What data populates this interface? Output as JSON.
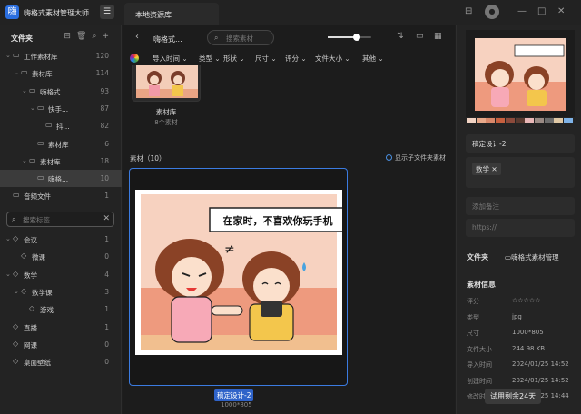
{
  "app": {
    "title": "嗨格式素材管理大师",
    "logo_glyph": "嗨"
  },
  "tab": {
    "label": "本地资源库"
  },
  "sidebar": {
    "folders_title": "文件夹",
    "tree": [
      {
        "label": "工作素材库",
        "count": "120",
        "level": 0
      },
      {
        "label": "素材库",
        "count": "114",
        "level": 1
      },
      {
        "label": "嗨格式...",
        "count": "93",
        "level": 2
      },
      {
        "label": "快手...",
        "count": "87",
        "level": 3
      },
      {
        "label": "抖...",
        "count": "82",
        "level": 4
      },
      {
        "label": "素材库",
        "count": "6",
        "level": 3
      },
      {
        "label": "素材库",
        "count": "18",
        "level": 2
      },
      {
        "label": "嗨格...",
        "count": "10",
        "level": 3
      },
      {
        "label": "音频文件",
        "count": "1",
        "level": 0
      }
    ],
    "tag_search_placeholder": "搜索标签",
    "tags": [
      {
        "label": "会议",
        "count": "1",
        "level": 0
      },
      {
        "label": "微课",
        "count": "0",
        "level": 1
      },
      {
        "label": "数学",
        "count": "4",
        "level": 0
      },
      {
        "label": "数学课",
        "count": "3",
        "level": 1
      },
      {
        "label": "游戏",
        "count": "1",
        "level": 2
      },
      {
        "label": "直播",
        "count": "1",
        "level": 0
      },
      {
        "label": "网课",
        "count": "0",
        "level": 0
      },
      {
        "label": "桌面壁纸",
        "count": "0",
        "level": 0
      }
    ]
  },
  "main": {
    "breadcrumb": "嗨格式...",
    "search_placeholder": "搜索素材",
    "zoom_fraction": 0.66,
    "filters": [
      "导入时间",
      "类型",
      "形状",
      "尺寸",
      "评分",
      "文件大小",
      "其他"
    ],
    "folder_card": {
      "name": "素材库",
      "count": "8个素材"
    },
    "section_label": "素材（10）",
    "show_subfolder": "显示子文件夹素材",
    "asset": {
      "name": "稿定设计-2",
      "size": "1000*805",
      "caption": "在家时，不喜欢你玩手机"
    }
  },
  "right": {
    "swatches": [
      "#f2d4c4",
      "#e8a98a",
      "#d9886a",
      "#c7603f",
      "#8c4a3b",
      "#5a3a30",
      "#e9b7b7",
      "#9a8a84",
      "#6c6c6c",
      "#e1c9a6",
      "#7fb3e8"
    ],
    "name": "稿定设计-2",
    "tag": "数学",
    "note_placeholder": "添加备注",
    "url_placeholder": "https://",
    "folder_label": "文件夹",
    "folder_value": "嗨格式素材管理",
    "info_title": "素材信息",
    "info": [
      {
        "k": "评分",
        "v": "☆☆☆☆☆"
      },
      {
        "k": "类型",
        "v": "jpg"
      },
      {
        "k": "尺寸",
        "v": "1000*805"
      },
      {
        "k": "文件大小",
        "v": "244.98 KB"
      },
      {
        "k": "导入时间",
        "v": "2024/01/25 14:52"
      },
      {
        "k": "创建时间",
        "v": "2024/01/25 14:52"
      },
      {
        "k": "修改时间",
        "v": "2024/01/25 14:44"
      }
    ],
    "trial": "试用剩余24天"
  }
}
